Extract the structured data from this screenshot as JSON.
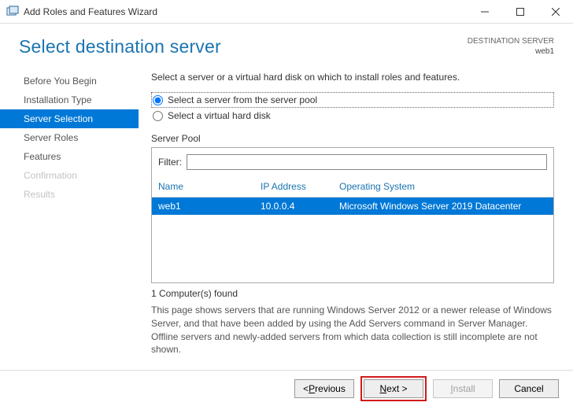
{
  "window": {
    "title": "Add Roles and Features Wizard"
  },
  "header": {
    "title": "Select destination server",
    "destination_label": "DESTINATION SERVER",
    "destination_value": "web1"
  },
  "nav": {
    "items": [
      {
        "label": "Before You Begin"
      },
      {
        "label": "Installation Type"
      },
      {
        "label": "Server Selection"
      },
      {
        "label": "Server Roles"
      },
      {
        "label": "Features"
      },
      {
        "label": "Confirmation"
      },
      {
        "label": "Results"
      }
    ]
  },
  "content": {
    "intro": "Select a server or a virtual hard disk on which to install roles and features.",
    "radio_pool": "Select a server from the server pool",
    "radio_vhd": "Select a virtual hard disk",
    "server_pool_label": "Server Pool",
    "filter_label": "Filter:",
    "filter_value": "",
    "columns": {
      "name": "Name",
      "ip": "IP Address",
      "os": "Operating System"
    },
    "rows": [
      {
        "name": "web1",
        "ip": "10.0.0.4",
        "os": "Microsoft Windows Server 2019 Datacenter"
      }
    ],
    "count_text": "1 Computer(s) found",
    "description": "This page shows servers that are running Windows Server 2012 or a newer release of Windows Server, and that have been added by using the Add Servers command in Server Manager. Offline servers and newly-added servers from which data collection is still incomplete are not shown."
  },
  "footer": {
    "previous_prefix": "< ",
    "previous_letter": "P",
    "previous_rest": "revious",
    "next_letter": "N",
    "next_rest": "ext >",
    "install_letter": "I",
    "install_rest": "nstall",
    "cancel": "Cancel"
  }
}
